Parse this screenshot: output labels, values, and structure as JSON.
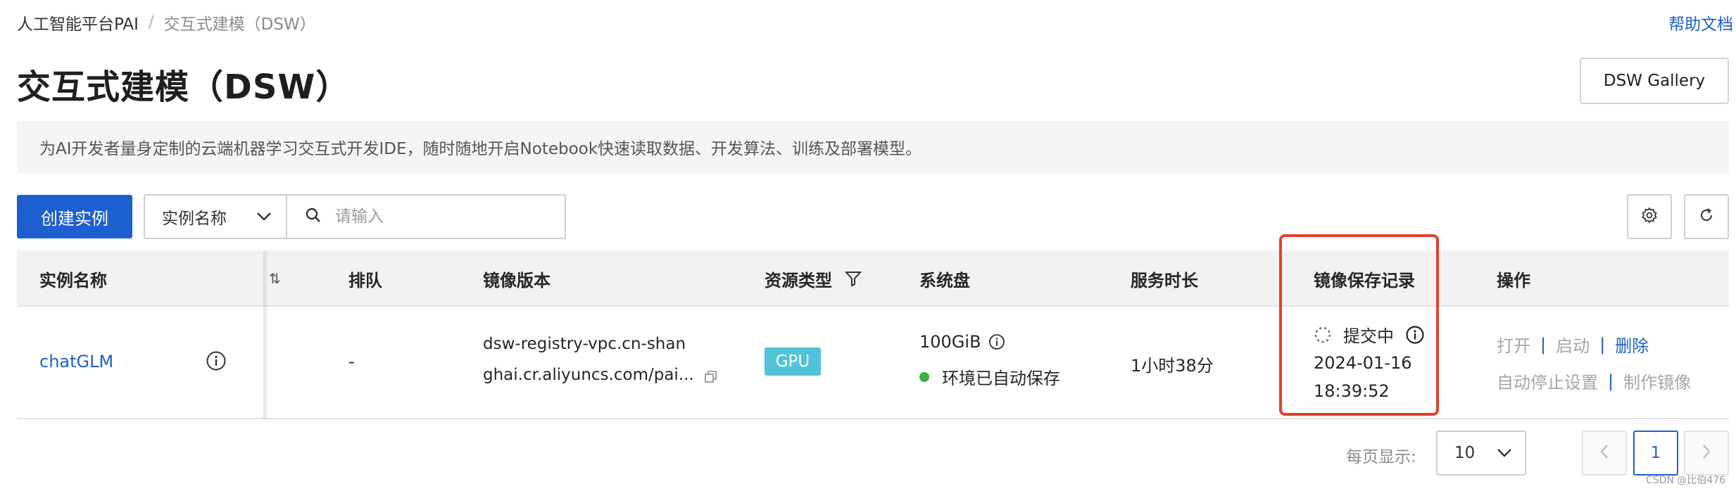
{
  "breadcrumb": {
    "root": "人工智能平台PAI",
    "separator": "/",
    "current": "交互式建模（DSW）"
  },
  "help_link": "帮助文档",
  "page_title": "交互式建模（DSW）",
  "gallery_button": "DSW Gallery",
  "description": "为AI开发者量身定制的云端机器学习交互式开发IDE，随时随地开启Notebook快速读取数据、开发算法、训练及部署模型。",
  "toolbar": {
    "create_label": "创建实例",
    "filter_field": "实例名称",
    "search_placeholder": "请输入"
  },
  "table": {
    "headers": {
      "name": "实例名称",
      "sort_glyph": "⇅",
      "queue": "排队",
      "image": "镜像版本",
      "resource": "资源类型",
      "disk": "系统盘",
      "duration": "服务时长",
      "image_save": "镜像保存记录",
      "ops": "操作"
    },
    "rows": [
      {
        "name": "chatGLM",
        "queue": "-",
        "image_line1": "dsw-registry-vpc.cn-shan",
        "image_line2": "ghai.cr.aliyuncs.com/pai...",
        "resource": "GPU",
        "disk_size": "100GiB",
        "disk_status": "环境已自动保存",
        "duration": "1小时38分",
        "save_status": "提交中",
        "save_date": "2024-01-16",
        "save_time": "18:39:52",
        "op_open": "打开",
        "op_start": "启动",
        "op_delete": "删除",
        "op_auto_stop": "自动停止设置",
        "op_make_image": "制作镜像"
      }
    ]
  },
  "pagination": {
    "per_page_label": "每页显示:",
    "page_size": "10",
    "current_page": "1"
  },
  "watermark": "CSDN @比伯476",
  "colors": {
    "primary": "#1e5fcf",
    "highlight": "#e2402f",
    "gpu_tag": "#52c2d8",
    "status_ok": "#3cb043"
  }
}
